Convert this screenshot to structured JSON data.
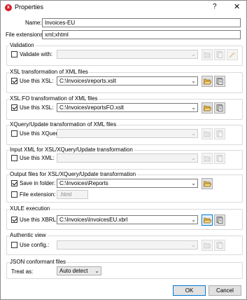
{
  "window": {
    "title": "Properties",
    "help": "?",
    "close": "✕"
  },
  "name": {
    "label": "Name:",
    "value": "Invoices-EU"
  },
  "extensions": {
    "label": "File extensions:",
    "value": "xml;xhtml"
  },
  "validation": {
    "title": "Validation",
    "checkbox_label": "Validate with:",
    "checked": false
  },
  "xsl": {
    "title": "XSL transformation of XML files",
    "checkbox_label": "Use this XSL:",
    "checked": true,
    "value": "C:\\Invoices\\reports.xslt"
  },
  "xslfo": {
    "title": "XSL:FO transformation of XML files",
    "checkbox_label": "Use this XSL:",
    "checked": true,
    "value": "C:\\Invoices\\reportsFO.xslt"
  },
  "xquery": {
    "title": "XQuery/Update transformation of XML files",
    "checkbox_label": "Use this XQuery:",
    "checked": false
  },
  "inputxml": {
    "title": "Input XML for XSL/XQuery/Update transformation",
    "checkbox_label": "Use this XML:",
    "checked": false
  },
  "output": {
    "title": "Output files for XSL/XQuery/Update transformation",
    "save_label": "Save in folder:",
    "save_checked": true,
    "save_value": "C:\\Invoices\\Reports",
    "ext_label": "File extension:",
    "ext_checked": false,
    "ext_value": ".html"
  },
  "xule": {
    "title": "XULE execution",
    "checkbox_label": "Use this XBRL:",
    "checked": true,
    "value": "C:\\Invoices\\InvoicesEU.xbrl"
  },
  "authentic": {
    "title": "Authentic view",
    "checkbox_label": "Use config.:",
    "checked": false
  },
  "json": {
    "title": "JSON conformant files",
    "treat_label": "Treat as:",
    "treat_value": "Auto detect"
  },
  "buttons": {
    "ok": "OK",
    "cancel": "Cancel"
  },
  "icons": {
    "app": "altova-app-icon",
    "browse": "open-folder-icon",
    "window": "window-list-icon",
    "validate": "validate-wand-icon"
  },
  "colors": {
    "accent": "#0078d7",
    "folder": "#e8b84a",
    "app_icon": "#d4202c"
  }
}
